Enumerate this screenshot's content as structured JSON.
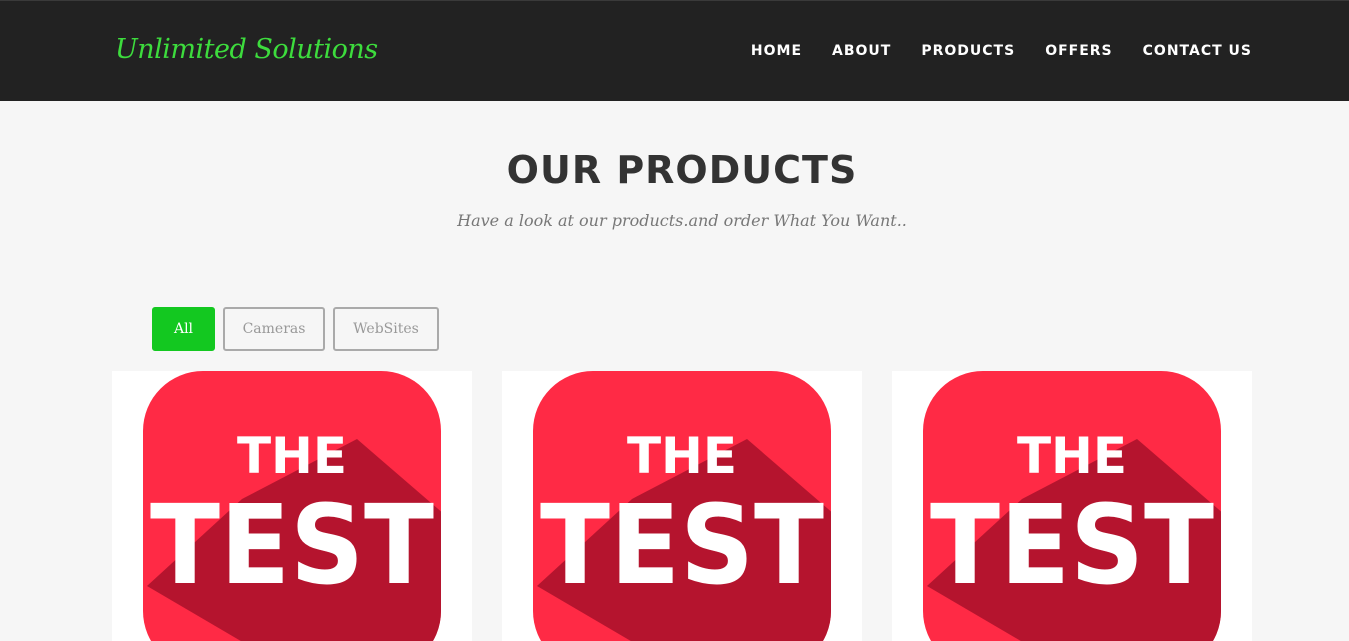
{
  "header": {
    "brand": "Unlimited Solutions",
    "nav": [
      {
        "label": "HOME"
      },
      {
        "label": "ABOUT"
      },
      {
        "label": "PRODUCTS"
      },
      {
        "label": "OFFERS"
      },
      {
        "label": "CONTACT US"
      }
    ]
  },
  "section": {
    "title": "OUR PRODUCTS",
    "subtitle": "Have a look at our products.and order What You Want.."
  },
  "filters": {
    "items": [
      {
        "label": "All",
        "active": true
      },
      {
        "label": "Cameras",
        "active": false
      },
      {
        "label": "WebSites",
        "active": false
      }
    ]
  },
  "products": [
    {
      "image_line1": "THE",
      "image_line2": "TEST",
      "image_icon": "the-test-app-icon"
    },
    {
      "image_line1": "THE",
      "image_line2": "TEST",
      "image_icon": "the-test-app-icon"
    },
    {
      "image_line1": "THE",
      "image_line2": "TEST",
      "image_icon": "the-test-app-icon"
    }
  ],
  "colors": {
    "navbar_bg": "#222222",
    "brand_green": "#3ddc3d",
    "filter_active": "#13c820",
    "icon_red": "#ff2a45",
    "icon_shadow": "#a8102a",
    "page_bg": "#f6f6f6"
  }
}
